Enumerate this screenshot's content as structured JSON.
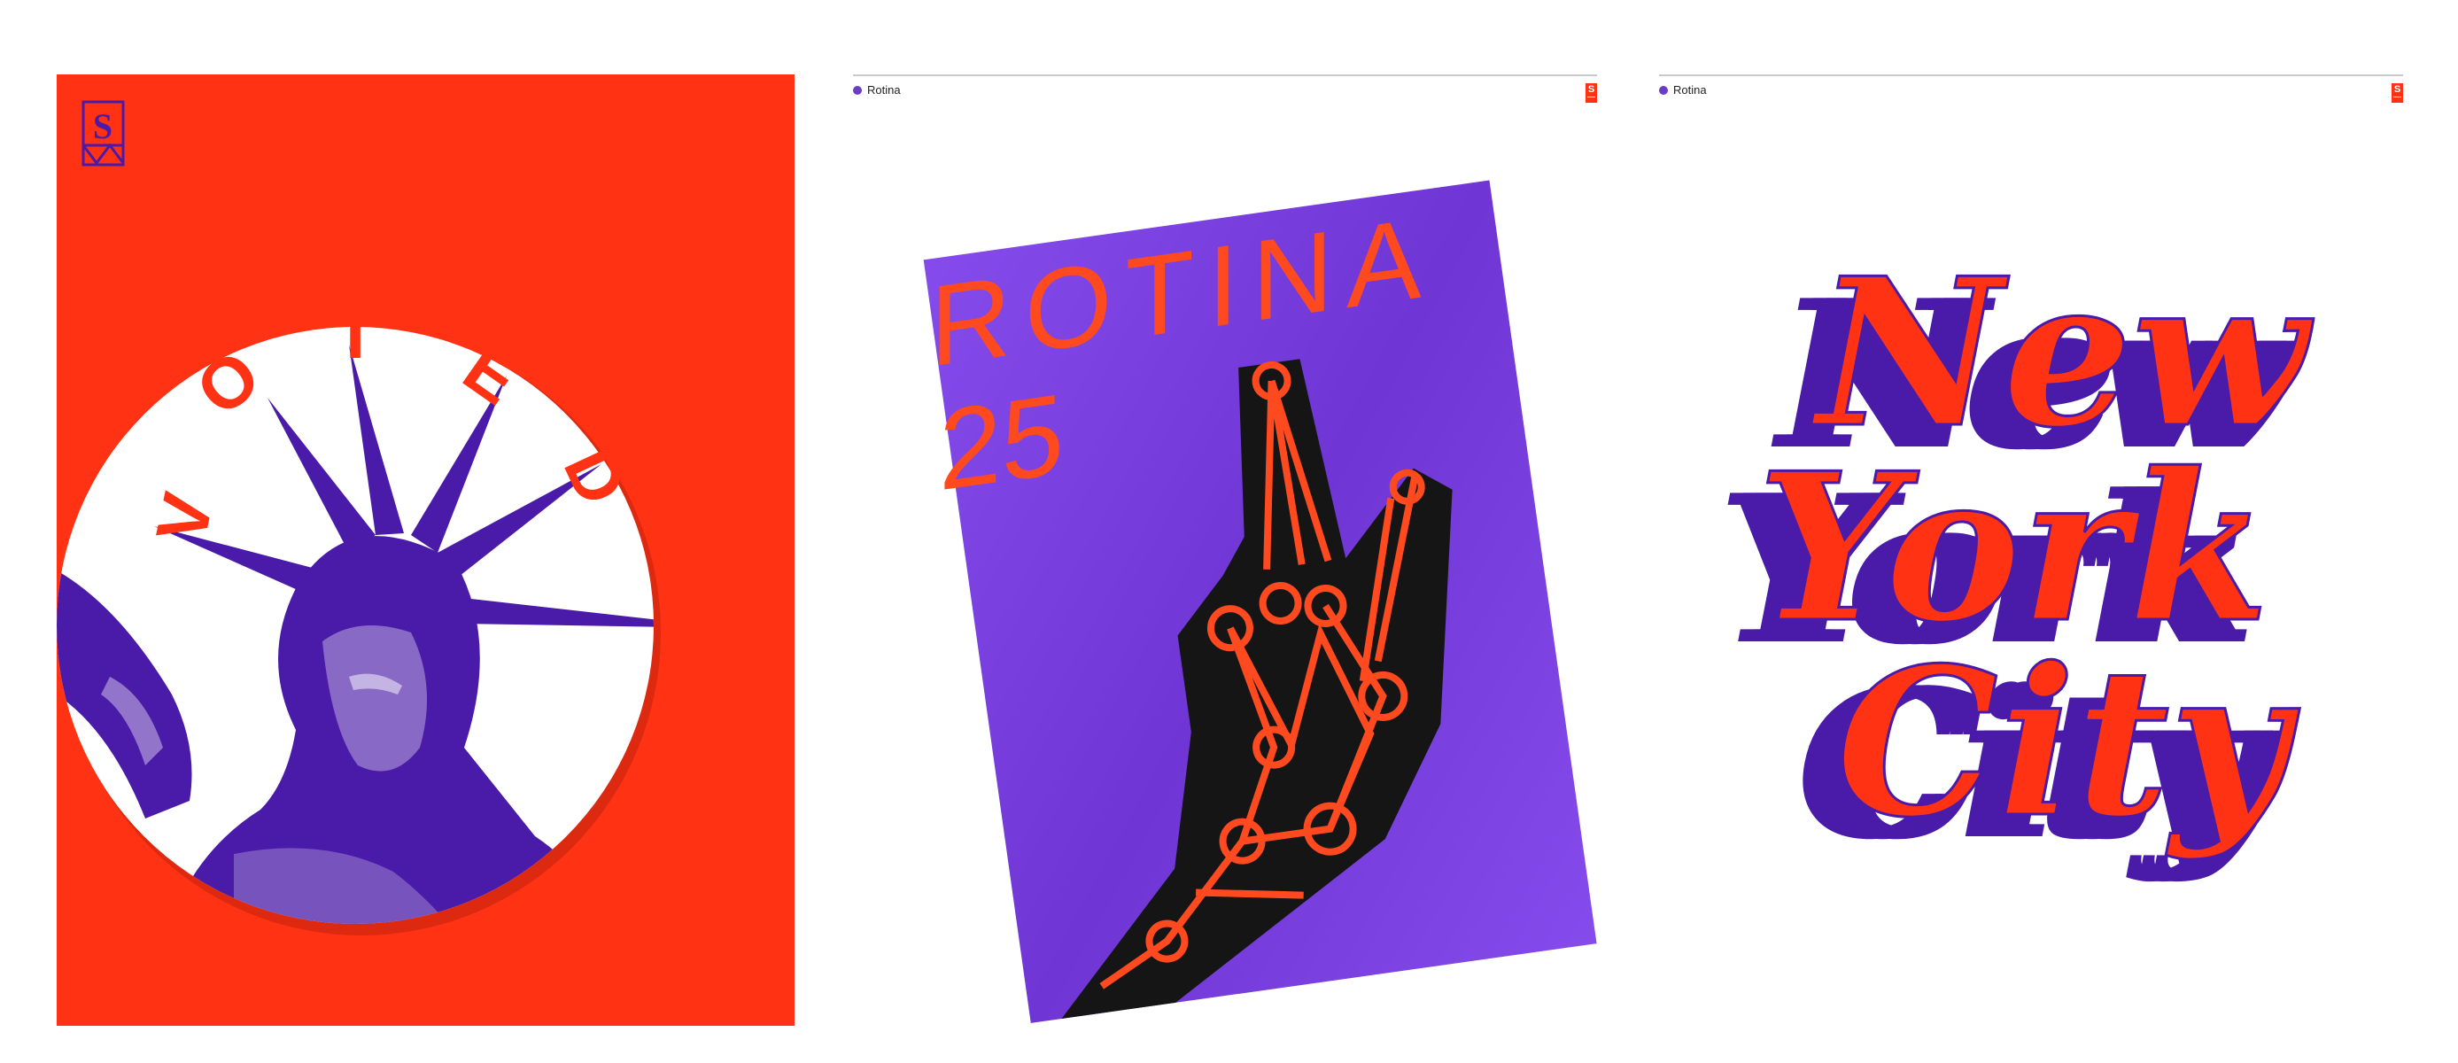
{
  "colors": {
    "red": "#ff3214",
    "purple": "#4a1aa8",
    "poster_purple": "#7a3ee0",
    "white": "#ffffff",
    "black": "#151515"
  },
  "voted": {
    "logo_letter": "S",
    "badge_text": "VOTED",
    "letters": [
      "V",
      "O",
      "T",
      "E",
      "D"
    ]
  },
  "rotina": {
    "tag_label": "Rotina",
    "logo_letter": "S",
    "poster_title": "ROTINA",
    "poster_number": "25"
  },
  "nyc": {
    "tag_label": "Rotina",
    "logo_letter": "S",
    "line1": "New",
    "line2": "York",
    "line3": "City"
  }
}
